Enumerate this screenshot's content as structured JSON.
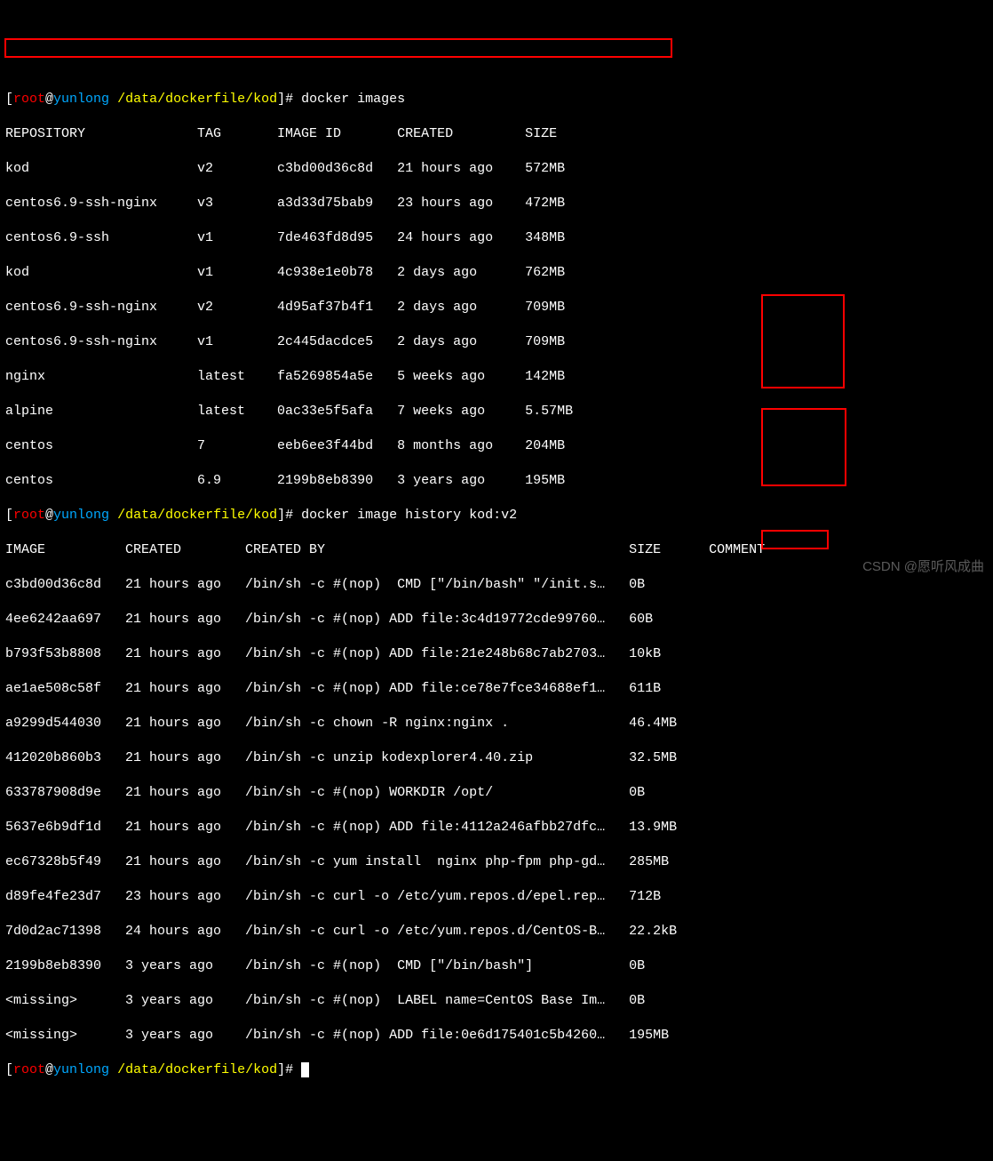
{
  "prompt1": {
    "open": "[",
    "user": "root",
    "at": "@",
    "host": "yunlong",
    "space": " ",
    "path": "/data/dockerfile/kod",
    "close": "]# ",
    "cmd": "docker images"
  },
  "images_header": "REPOSITORY              TAG       IMAGE ID       CREATED         SIZE",
  "images_rows": [
    "kod                     v2        c3bd00d36c8d   21 hours ago    572MB",
    "centos6.9-ssh-nginx     v3        a3d33d75bab9   23 hours ago    472MB",
    "centos6.9-ssh           v1        7de463fd8d95   24 hours ago    348MB",
    "kod                     v1        4c938e1e0b78   2 days ago      762MB",
    "centos6.9-ssh-nginx     v2        4d95af37b4f1   2 days ago      709MB",
    "centos6.9-ssh-nginx     v1        2c445dacdce5   2 days ago      709MB",
    "nginx                   latest    fa5269854a5e   5 weeks ago     142MB",
    "alpine                  latest    0ac33e5f5afa   7 weeks ago     5.57MB",
    "centos                  7         eeb6ee3f44bd   8 months ago    204MB",
    "centos                  6.9       2199b8eb8390   3 years ago     195MB"
  ],
  "prompt2": {
    "open": "[",
    "user": "root",
    "at": "@",
    "host": "yunlong",
    "space": " ",
    "path": "/data/dockerfile/kod",
    "close": "]# ",
    "cmd": "docker image history kod:v2"
  },
  "history_header": "IMAGE          CREATED        CREATED BY                                      SIZE      COMMENT",
  "history_rows": [
    "c3bd00d36c8d   21 hours ago   /bin/sh -c #(nop)  CMD [\"/bin/bash\" \"/init.s…   0B",
    "4ee6242aa697   21 hours ago   /bin/sh -c #(nop) ADD file:3c4d19772cde99760…   60B",
    "b793f53b8808   21 hours ago   /bin/sh -c #(nop) ADD file:21e248b68c7ab2703…   10kB",
    "ae1ae508c58f   21 hours ago   /bin/sh -c #(nop) ADD file:ce78e7fce34688ef1…   611B",
    "a9299d544030   21 hours ago   /bin/sh -c chown -R nginx:nginx .               46.4MB",
    "412020b860b3   21 hours ago   /bin/sh -c unzip kodexplorer4.40.zip            32.5MB",
    "633787908d9e   21 hours ago   /bin/sh -c #(nop) WORKDIR /opt/                 0B",
    "5637e6b9df1d   21 hours ago   /bin/sh -c #(nop) ADD file:4112a246afbb27dfc…   13.9MB",
    "ec67328b5f49   21 hours ago   /bin/sh -c yum install  nginx php-fpm php-gd…   285MB",
    "d89fe4fe23d7   23 hours ago   /bin/sh -c curl -o /etc/yum.repos.d/epel.rep…   712B",
    "7d0d2ac71398   24 hours ago   /bin/sh -c curl -o /etc/yum.repos.d/CentOS-B…   22.2kB",
    "2199b8eb8390   3 years ago    /bin/sh -c #(nop)  CMD [\"/bin/bash\"]            0B",
    "<missing>      3 years ago    /bin/sh -c #(nop)  LABEL name=CentOS Base Im…   0B",
    "<missing>      3 years ago    /bin/sh -c #(nop) ADD file:0e6d175401c5b4260…   195MB"
  ],
  "prompt3": {
    "open": "[",
    "user": "root",
    "at": "@",
    "host": "yunlong",
    "space": " ",
    "path": "/data/dockerfile/kod",
    "close": "]# "
  },
  "watermark": "CSDN @愿听风成曲"
}
